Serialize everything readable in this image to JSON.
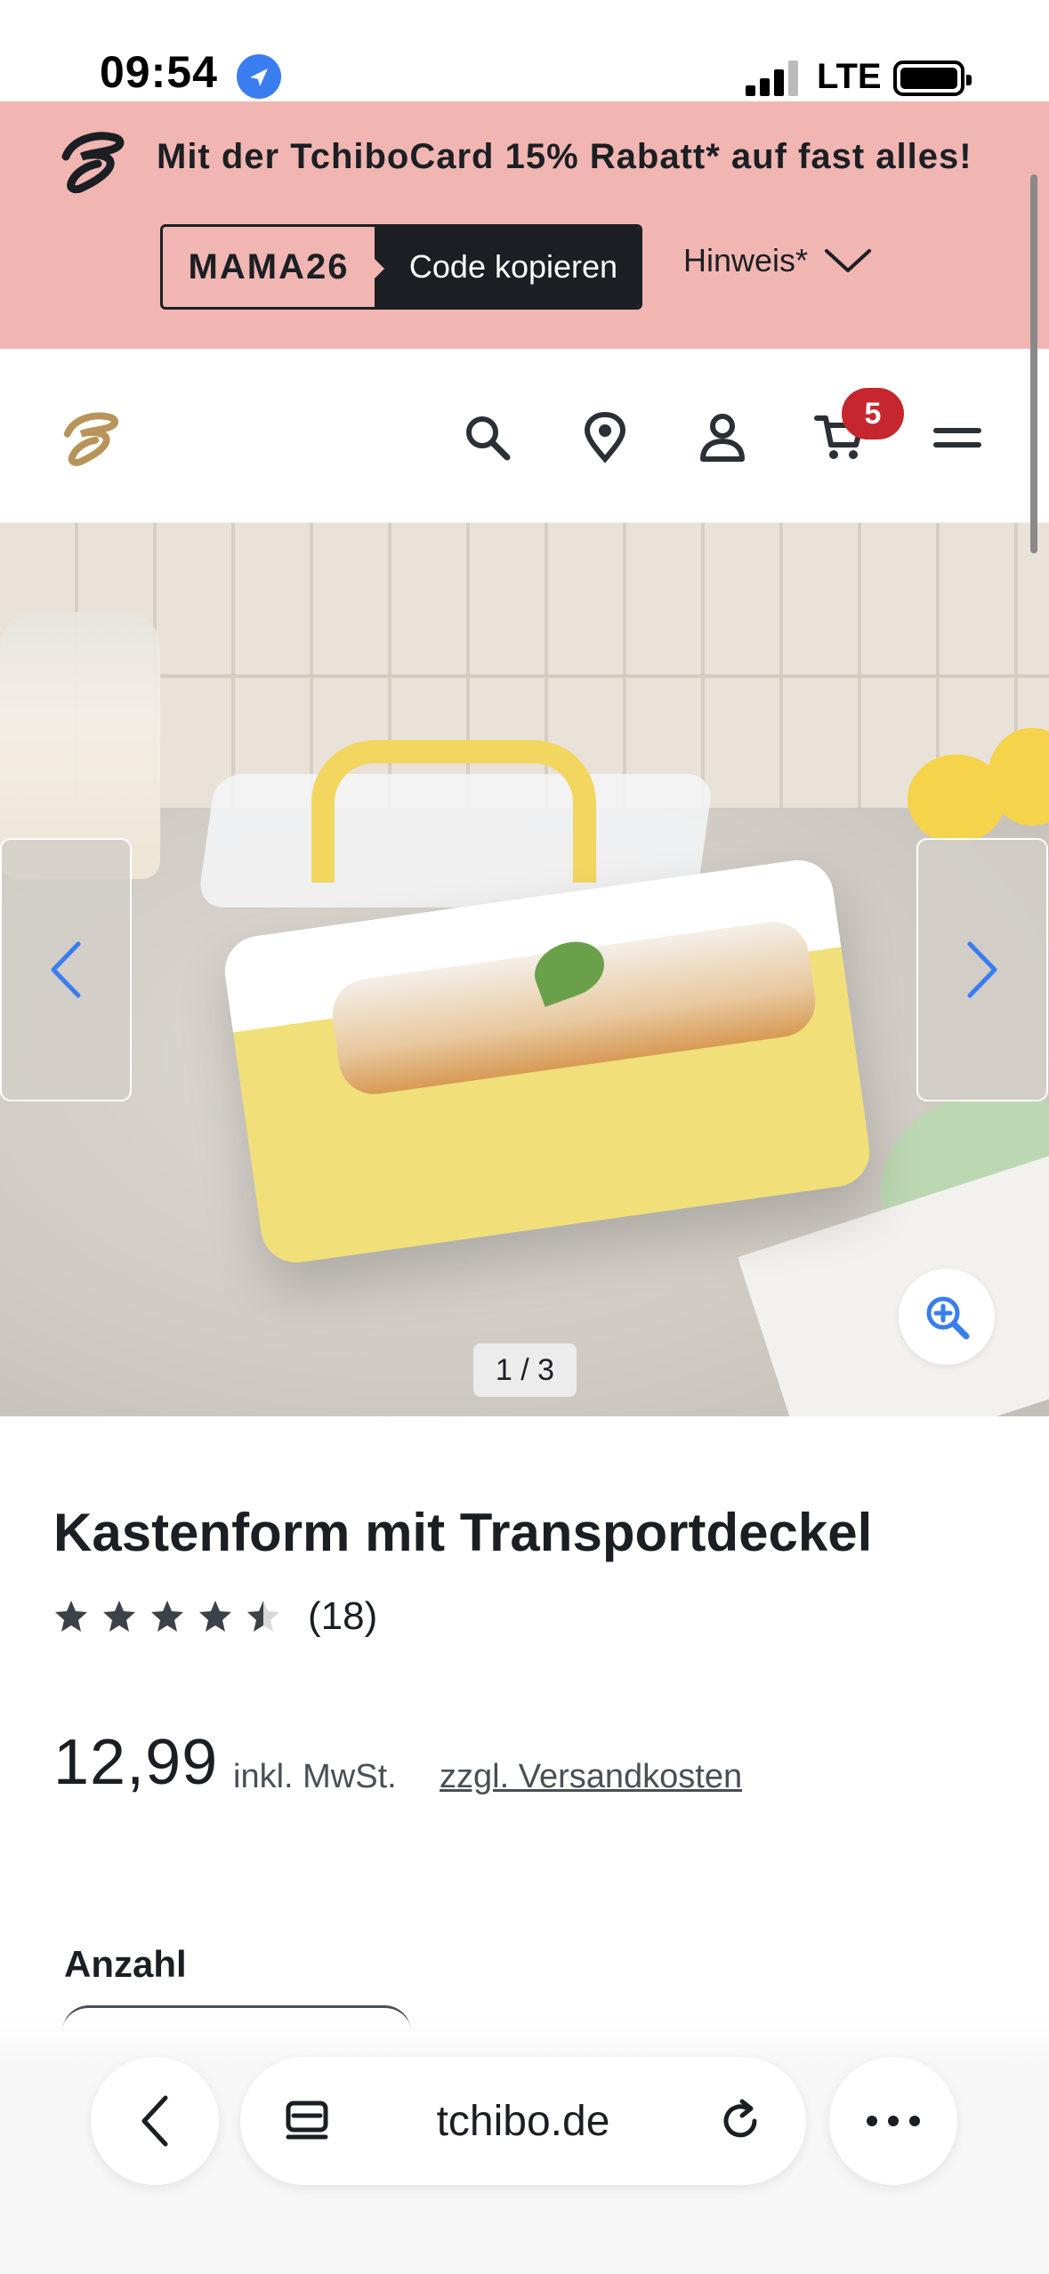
{
  "status_bar": {
    "time": "09:54",
    "network": "LTE"
  },
  "promo": {
    "text": "Mit der TchiboCard 15% Rabatt* auf fast alles!",
    "code": "MAMA26",
    "copy_label": "Code kopieren",
    "hint_label": "Hinweis*",
    "background": "#f1b6b2"
  },
  "header": {
    "cart_count": "5",
    "icons": [
      "search-icon",
      "location-pin-icon",
      "account-icon",
      "cart-icon",
      "menu-icon"
    ]
  },
  "gallery": {
    "pager": "1 / 3"
  },
  "product": {
    "title": "Kastenform mit Transportdeckel",
    "rating_value": 4.5,
    "rating_max": 5,
    "review_count": "(18)",
    "price": "12,99",
    "tax_label": "inkl. MwSt.",
    "shipping_label": "zzgl. Versandkosten",
    "quantity_label": "Anzahl"
  },
  "browser": {
    "url": "tchibo.de"
  },
  "colors": {
    "accent_blue": "#3a7df0",
    "badge_red": "#c6262e",
    "brand_gold": "#b8945a",
    "dark": "#1b1f24"
  }
}
